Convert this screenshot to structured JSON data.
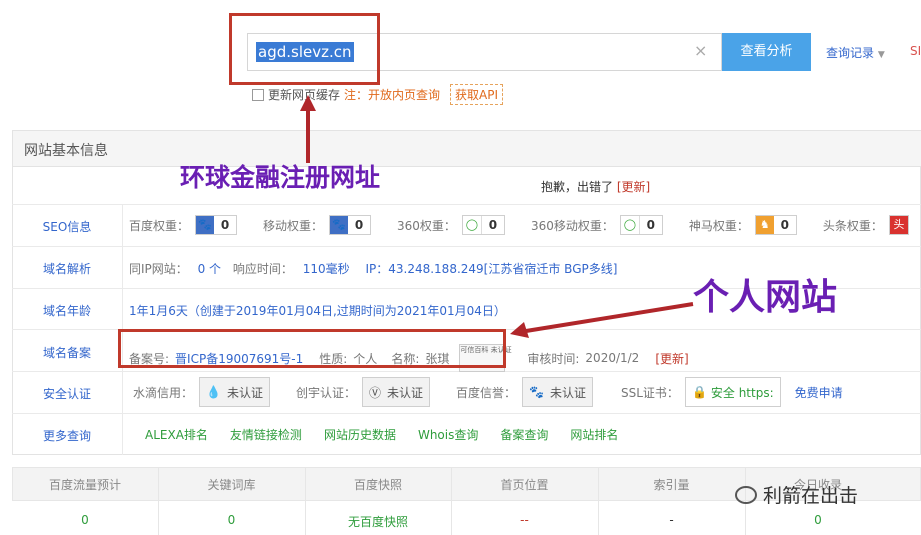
{
  "search": {
    "query": "agd.slevz.cn",
    "clear_icon": "×",
    "button": "查看分析",
    "history": "查询记录",
    "seo_cut": "SI"
  },
  "cache": {
    "label": "更新网页缓存",
    "note": "注：开放内页查询",
    "api": "获取API"
  },
  "panel": {
    "title": "网站基本信息",
    "error_text": "抱歉，出错了",
    "update": "[更新]"
  },
  "annotations": {
    "finance": "环球金融注册网址",
    "personal": "个人网站"
  },
  "seo": {
    "label": "SEO信息",
    "items": [
      {
        "name": "百度权重：",
        "value": "0"
      },
      {
        "name": "移动权重：",
        "value": "0"
      },
      {
        "name": "360权重：",
        "value": "0"
      },
      {
        "name": "360移动权重：",
        "value": "0"
      },
      {
        "name": "神马权重：",
        "value": "0"
      },
      {
        "name": "头条权重：",
        "value": ""
      }
    ]
  },
  "dns": {
    "label": "域名解析",
    "same_ip": "同IP网站：",
    "same_ip_val": "0 个",
    "resp": "响应时间：",
    "resp_val": "110毫秒",
    "ip": "IP：43.248.188.249[江苏省宿迁市 BGP多线]"
  },
  "age": {
    "label": "域名年龄",
    "value": "1年1月6天（创建于2019年01月04日,过期时间为2021年01月04日）"
  },
  "icp": {
    "label": "域名备案",
    "no_label": "备案号:",
    "no_val": "晋ICP备19007691号-1",
    "nature_label": "性质:",
    "nature_val": "个人",
    "name_label": "名称:",
    "name_val": "张琪",
    "trust_badge": "可信百科 未认证",
    "audit_label": "审核时间:",
    "audit_val": "2020/1/2",
    "update": "[更新]"
  },
  "security": {
    "label": "安全认证",
    "shuidi": "水滴信用：",
    "shuidi_badge": "未认证",
    "chuangyu": "创宇认证：",
    "chuangyu_badge": "未认证",
    "baidu": "百度信誉：",
    "baidu_badge": "未认证",
    "ssl": "SSL证书：",
    "ssl_badge": "安全 https:",
    "apply": "免费申请"
  },
  "more": {
    "label": "更多查询",
    "links": [
      "ALEXA排名",
      "友情链接检测",
      "网站历史数据",
      "Whois查询",
      "备案查询",
      "网站排名"
    ]
  },
  "table": {
    "headers": [
      "百度流量预计",
      "关键词库",
      "百度快照",
      "首页位置",
      "索引量",
      "今日收录"
    ],
    "values": [
      "0",
      "0",
      "无百度快照",
      "--",
      "-",
      "0"
    ]
  },
  "watermark": "利箭在出击"
}
